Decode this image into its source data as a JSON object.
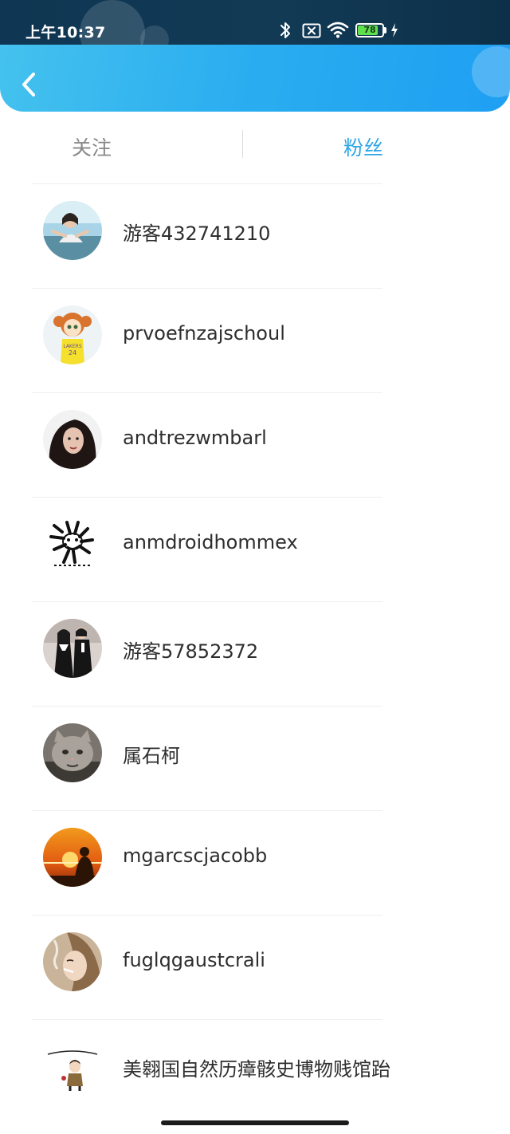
{
  "status_bar": {
    "time": "上午10:37",
    "battery_level": "78",
    "icons": [
      "bluetooth-icon",
      "no-sim-icon",
      "wifi-icon",
      "battery-icon",
      "charging-icon"
    ]
  },
  "header": {
    "back_icon": "chevron-left-icon",
    "gradient_colors": [
      "#45c2ee",
      "#1f9ff2"
    ]
  },
  "tabs": [
    {
      "label": "关注",
      "active": false
    },
    {
      "label": "粉丝",
      "active": true
    }
  ],
  "accent_color": "#2fa6e4",
  "users": [
    {
      "name": "游客432741210",
      "avatar": "photo-girl-avatar"
    },
    {
      "name": "prvoefnzajschoul",
      "avatar": "cartoon-girl-avatar"
    },
    {
      "name": "andtrezwmbarl",
      "avatar": "photo-woman-avatar"
    },
    {
      "name": "anmdroidhommex",
      "avatar": "tiger-sketch-avatar"
    },
    {
      "name": "游客57852372",
      "avatar": "photo-couple-avatar"
    },
    {
      "name": "属石柯",
      "avatar": "cat-avatar"
    },
    {
      "name": "mgarcscjacobb",
      "avatar": "sunset-buddha-avatar"
    },
    {
      "name": "fuglqgaustcrali",
      "avatar": "photo-woman-smoke-avatar"
    },
    {
      "name": "美翱国自然历瘴骸史博物贱馆跆",
      "avatar": "cartoon-boy-avatar"
    }
  ]
}
